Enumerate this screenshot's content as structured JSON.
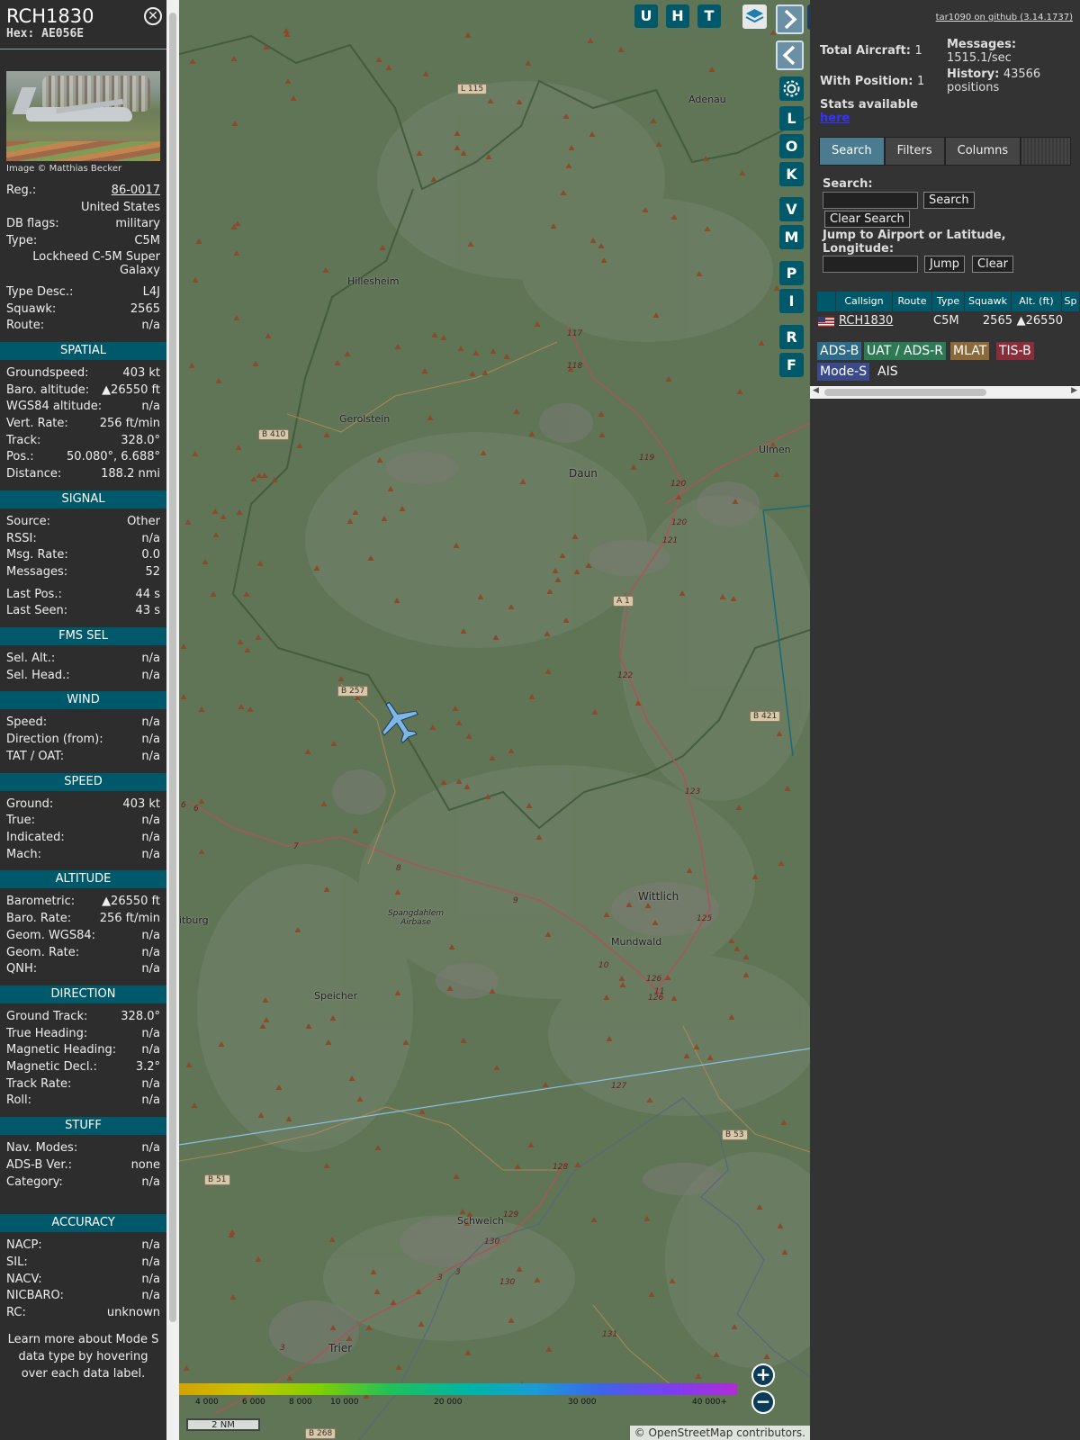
{
  "aircraft": {
    "callsign": "RCH1830",
    "hex_label": "Hex:",
    "hex": "AE056E",
    "photo_credit": "Image © Matthias Becker",
    "details": [
      {
        "k": "Reg.:",
        "v": "86-0017",
        "link": true
      },
      {
        "k": "",
        "v": "United States"
      },
      {
        "k": "DB flags:",
        "v": "military"
      },
      {
        "k": "Type:",
        "v": "C5M"
      }
    ],
    "type_long": "Lockheed C-5M Super Galaxy",
    "details2": [
      {
        "k": "Type Desc.:",
        "v": "L4J"
      },
      {
        "k": "Squawk:",
        "v": "2565"
      },
      {
        "k": "Route:",
        "v": "n/a"
      }
    ],
    "sections": [
      {
        "title": "SPATIAL",
        "rows": [
          {
            "k": "Groundspeed:",
            "v": "403 kt"
          },
          {
            "k": "Baro. altitude:",
            "v": "▲26550 ft"
          },
          {
            "k": "WGS84 altitude:",
            "v": "n/a"
          },
          {
            "k": "Vert. Rate:",
            "v": "256 ft/min"
          },
          {
            "k": "Track:",
            "v": "328.0°"
          },
          {
            "k": "Pos.:",
            "v": "50.080°, 6.688°"
          },
          {
            "k": "Distance:",
            "v": "188.2 nmi"
          }
        ]
      },
      {
        "title": "SIGNAL",
        "rows": [
          {
            "k": "Source:",
            "v": "Other"
          },
          {
            "k": "RSSI:",
            "v": "n/a"
          },
          {
            "k": "Msg. Rate:",
            "v": "0.0"
          },
          {
            "k": "Messages:",
            "v": "52"
          },
          {
            "k": "",
            "v": ""
          },
          {
            "k": "Last Pos.:",
            "v": "44 s"
          },
          {
            "k": "Last Seen:",
            "v": "43 s"
          }
        ]
      },
      {
        "title": "FMS SEL",
        "rows": [
          {
            "k": "Sel. Alt.:",
            "v": "n/a"
          },
          {
            "k": "Sel. Head.:",
            "v": "n/a"
          }
        ]
      },
      {
        "title": "WIND",
        "rows": [
          {
            "k": "Speed:",
            "v": "n/a"
          },
          {
            "k": "Direction (from):",
            "v": "n/a"
          },
          {
            "k": "TAT / OAT:",
            "v": "n/a"
          }
        ]
      },
      {
        "title": "SPEED",
        "rows": [
          {
            "k": "Ground:",
            "v": "403 kt"
          },
          {
            "k": "True:",
            "v": "n/a"
          },
          {
            "k": "Indicated:",
            "v": "n/a"
          },
          {
            "k": "Mach:",
            "v": "n/a"
          }
        ]
      },
      {
        "title": "ALTITUDE",
        "rows": [
          {
            "k": "Barometric:",
            "v": "▲26550 ft"
          },
          {
            "k": "Baro. Rate:",
            "v": "256 ft/min"
          },
          {
            "k": "Geom. WGS84:",
            "v": "n/a"
          },
          {
            "k": "Geom. Rate:",
            "v": "n/a"
          },
          {
            "k": "QNH:",
            "v": "n/a"
          }
        ]
      },
      {
        "title": "DIRECTION",
        "rows": [
          {
            "k": "Ground Track:",
            "v": "328.0°"
          },
          {
            "k": "True Heading:",
            "v": "n/a"
          },
          {
            "k": "Magnetic Heading:",
            "v": "n/a"
          },
          {
            "k": "Magnetic Decl.:",
            "v": "3.2°"
          },
          {
            "k": "Track Rate:",
            "v": "n/a"
          },
          {
            "k": "Roll:",
            "v": "n/a"
          }
        ]
      },
      {
        "title": "STUFF",
        "rows": [
          {
            "k": "Nav. Modes:",
            "v": "n/a"
          },
          {
            "k": "ADS-B Ver.:",
            "v": "none"
          },
          {
            "k": "Category:",
            "v": "n/a"
          }
        ]
      },
      {
        "title": "ACCURACY",
        "rows": [
          {
            "k": "NACP:",
            "v": "n/a"
          },
          {
            "k": "SIL:",
            "v": "n/a"
          },
          {
            "k": "NACV:",
            "v": "n/a"
          },
          {
            "k": "NICBARO:",
            "v": "n/a"
          },
          {
            "k": "RC:",
            "v": "unknown"
          }
        ]
      }
    ],
    "learn_more": "Learn more about Mode S data type by hovering over each data label."
  },
  "map": {
    "places": [
      "Adenau",
      "Hillesheim",
      "Gerolstein",
      "Daun",
      "Ulmen",
      "Wittlich",
      "Mundwald",
      "Speicher",
      "Spangdahlem Airbase",
      "itburg",
      "Schweich",
      "Trier"
    ],
    "road_labels": [
      "L 115",
      "B 410",
      "A 1",
      "B 257",
      "B 421",
      "B 53",
      "B 51",
      "B 268"
    ],
    "exit_labels": [
      "117",
      "118",
      "119",
      "120",
      "120",
      "121",
      "122",
      "123",
      "125",
      "126",
      "126",
      "127",
      "128",
      "129",
      "130",
      "130",
      "131",
      "6",
      "6",
      "7",
      "8",
      "9",
      "10",
      "11",
      "3",
      "3",
      "3"
    ],
    "buttons": [
      "U",
      "H",
      "T",
      "L",
      "O",
      "K",
      "V",
      "M",
      "P",
      "I",
      "R",
      "F"
    ],
    "zoom_in": "+",
    "zoom_out": "−",
    "alt_ticks": [
      "4 000",
      "6 000",
      "8 000",
      "10 000",
      "20 000",
      "30 000",
      "40 000+"
    ],
    "scale": "2 NM",
    "attribution_prefix": "© ",
    "attribution_link": "OpenStreetMap",
    "attribution_suffix": " contributors."
  },
  "sidebar": {
    "github": "tar1090 on github (3.14.1737)",
    "total_label": "Total Aircraft:",
    "total": "1",
    "messages_label": "Messages:",
    "messages": "1515.1/sec",
    "withpos_label": "With Position:",
    "withpos": "1",
    "history_label": "History:",
    "history": "43566 positions",
    "stats_text": "Stats available",
    "stats_link": "here",
    "tabs": [
      "Search",
      "Filters",
      "Columns"
    ],
    "search_label": "Search:",
    "search_btn": "Search",
    "clear_search_btn": "Clear Search",
    "jump_label": "Jump to Airport or Latitude, Longitude:",
    "jump_btn": "Jump",
    "clear_btn": "Clear",
    "columns": [
      "",
      "Callsign",
      "Route",
      "Type",
      "Squawk",
      "Alt. (ft)",
      "Sp"
    ],
    "row": {
      "callsign": "RCH1830",
      "route": "",
      "type": "C5M",
      "squawk": "2565",
      "alt": "▲26550"
    },
    "badges": [
      {
        "label": "ADS-B",
        "color": "#2d6a8a"
      },
      {
        "label": "UAT / ADS-R",
        "color": "#2d7a55"
      },
      {
        "label": "MLAT",
        "color": "#8a6a3a"
      },
      {
        "label": "TIS-B",
        "color": "#8a2d3a"
      },
      {
        "label": "Mode-S",
        "color": "#3a4a8a"
      },
      {
        "label": "AIS",
        "color": ""
      }
    ]
  }
}
